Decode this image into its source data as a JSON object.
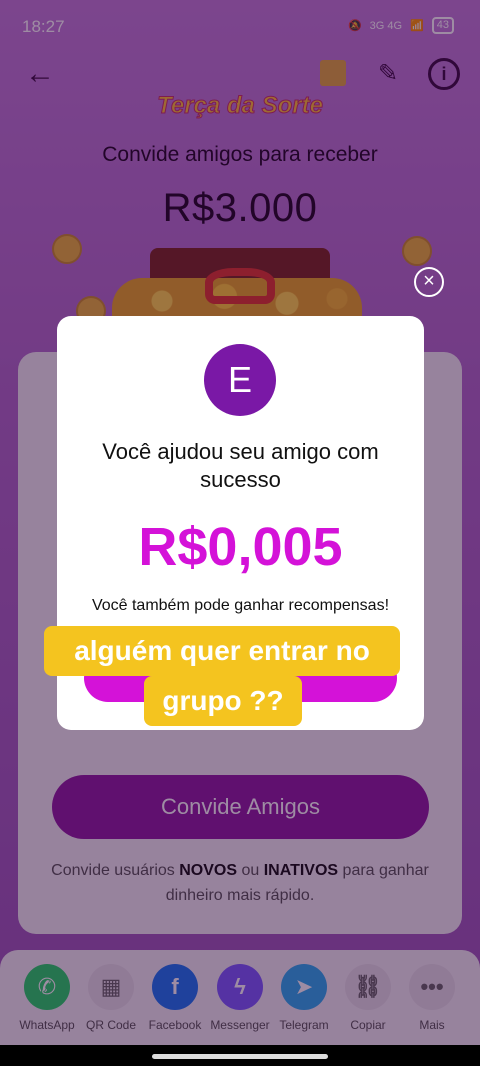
{
  "status_bar": {
    "time": "18:27",
    "network": "3G 4G",
    "battery": "43"
  },
  "header": {
    "event_title": "Terça da Sorte",
    "subtitle": "Convide amigos para receber",
    "prize_amount": "R$3.000"
  },
  "modal": {
    "avatar_letter": "E",
    "title": "Você ajudou seu amigo com sucesso",
    "amount": "R$0,005",
    "subtitle": "Você também pode ganhar recompensas!"
  },
  "overlay_caption": {
    "line1": "alguém quer entrar no",
    "line2": "grupo ??"
  },
  "main": {
    "invite_button": "Convide Amigos",
    "hint_prefix": "Convide usuários ",
    "hint_new": "NOVOS",
    "hint_or": " ou ",
    "hint_inactive": "INATIVOS",
    "hint_suffix": " para ganhar dinheiro mais rápido."
  },
  "share": [
    {
      "label": "WhatsApp",
      "icon": "whatsapp-icon",
      "color": "#25D366"
    },
    {
      "label": "QR Code",
      "icon": "qr-code-icon",
      "color": "#e6e1e8"
    },
    {
      "label": "Facebook",
      "icon": "facebook-icon",
      "color": "#1877F2"
    },
    {
      "label": "Messenger",
      "icon": "messenger-icon",
      "color": "#7a5cff"
    },
    {
      "label": "Telegram",
      "icon": "telegram-icon",
      "color": "#2AABEE"
    },
    {
      "label": "Copiar",
      "icon": "link-icon",
      "color": "#e6e1e8"
    },
    {
      "label": "Mais",
      "icon": "more-icon",
      "color": "#e6e1e8"
    }
  ],
  "colors": {
    "accent": "#d412d8",
    "invite": "#8e1ea0",
    "avatar": "#7a18a6",
    "caption": "#f4c41f"
  }
}
